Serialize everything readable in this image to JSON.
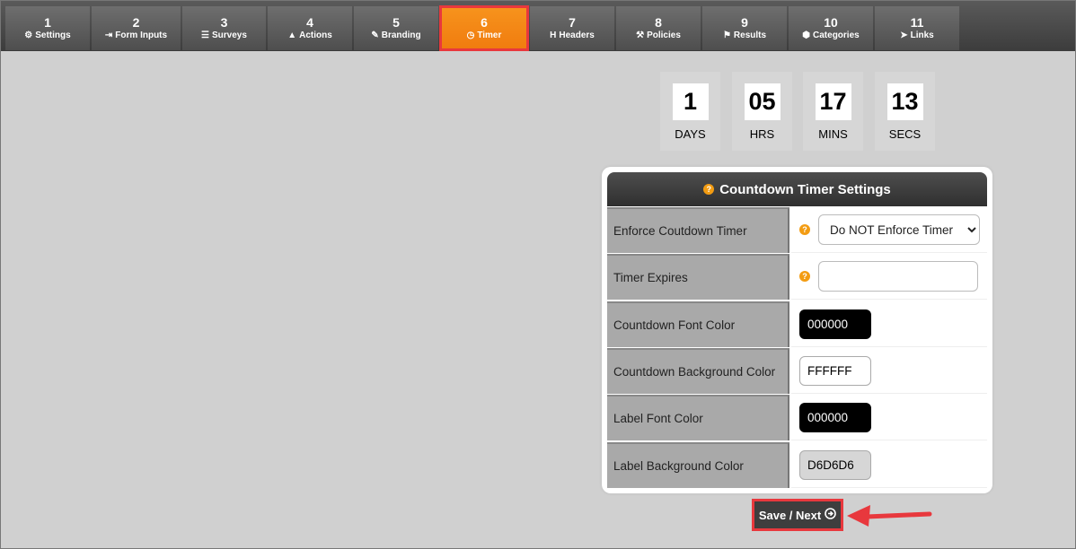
{
  "tabs": [
    {
      "num": "1",
      "label": "Settings",
      "icon": "gear-icon",
      "glyph": "⚙"
    },
    {
      "num": "2",
      "label": "Form Inputs",
      "icon": "sign-in-icon",
      "glyph": "⇥"
    },
    {
      "num": "3",
      "label": "Surveys",
      "icon": "list-icon",
      "glyph": "☰"
    },
    {
      "num": "4",
      "label": "Actions",
      "icon": "user-icon",
      "glyph": "▲"
    },
    {
      "num": "5",
      "label": "Branding",
      "icon": "brush-icon",
      "glyph": "✎"
    },
    {
      "num": "6",
      "label": "Timer",
      "icon": "clock-icon",
      "glyph": "◷"
    },
    {
      "num": "7",
      "label": "Headers",
      "icon": "header-icon",
      "glyph": "H"
    },
    {
      "num": "8",
      "label": "Policies",
      "icon": "gavel-icon",
      "glyph": "⚒"
    },
    {
      "num": "9",
      "label": "Results",
      "icon": "flag-icon",
      "glyph": "⚑"
    },
    {
      "num": "10",
      "label": "Categories",
      "icon": "cubes-icon",
      "glyph": "⬢"
    },
    {
      "num": "11",
      "label": "Links",
      "icon": "pointer-icon",
      "glyph": "➤"
    }
  ],
  "active_tab": "6",
  "countdown": {
    "days": {
      "value": "1",
      "label": "DAYS"
    },
    "hrs": {
      "value": "05",
      "label": "HRS"
    },
    "mins": {
      "value": "17",
      "label": "MINS"
    },
    "secs": {
      "value": "13",
      "label": "SECS"
    }
  },
  "panel": {
    "title": "Countdown Timer Settings",
    "rows": {
      "enforce": {
        "label": "Enforce Coutdown Timer",
        "value": "Do NOT Enforce Timer"
      },
      "expires": {
        "label": "Timer Expires",
        "value": ""
      },
      "font_color": {
        "label": "Countdown Font Color",
        "value": "000000"
      },
      "bg_color": {
        "label": "Countdown Background Color",
        "value": "FFFFFF"
      },
      "label_font_color": {
        "label": "Label Font Color",
        "value": "000000"
      },
      "label_bg_color": {
        "label": "Label Background Color",
        "value": "D6D6D6"
      }
    }
  },
  "save_button": {
    "label": "Save / Next"
  },
  "colors": {
    "accent": "#f7941d",
    "highlight": "#e8383d",
    "dark": "#3e3e3e"
  }
}
